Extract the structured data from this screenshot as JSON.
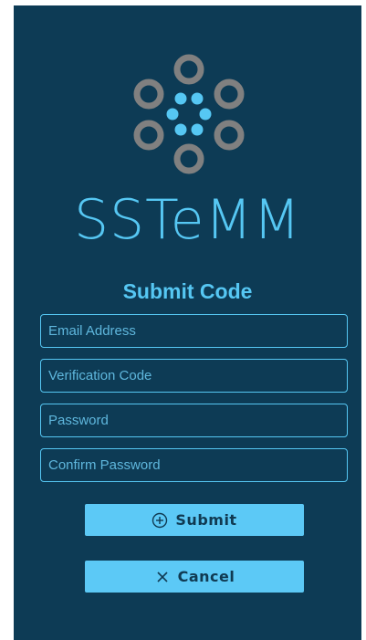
{
  "app": {
    "brand": "SSTeMM",
    "logo_icon": "sstemm-logo-icon"
  },
  "form": {
    "title": "Submit Code",
    "fields": {
      "email_placeholder": "Email Address",
      "code_placeholder": "Verification Code",
      "password_placeholder": "Password",
      "confirm_placeholder": "Confirm Password"
    },
    "buttons": {
      "submit_label": "Submit",
      "submit_icon": "plus-circle-icon",
      "cancel_label": "Cancel",
      "cancel_icon": "close-icon"
    }
  },
  "colors": {
    "background": "#0d3b55",
    "accent": "#56c7f3",
    "button": "#5cc9f6",
    "logo_ring": "#808080"
  }
}
